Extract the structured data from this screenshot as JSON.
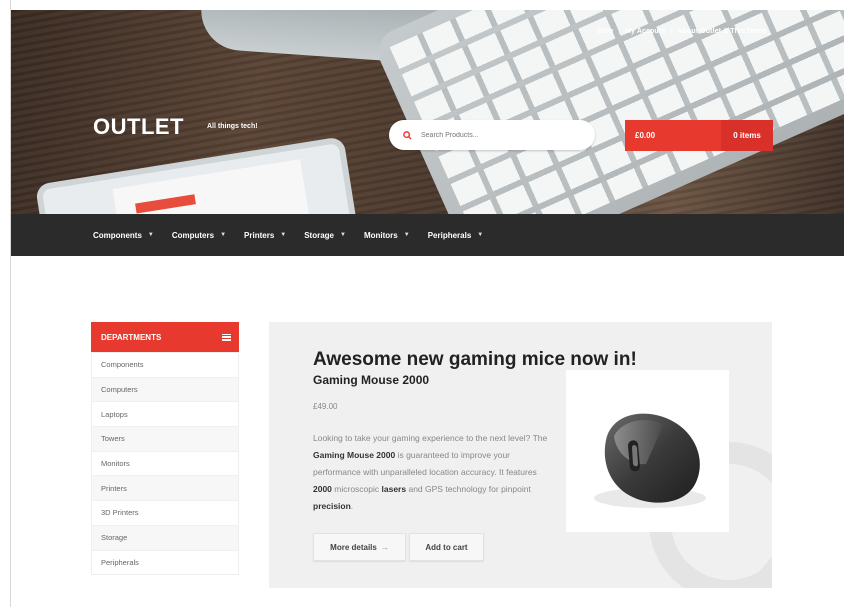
{
  "header": {
    "top_links": [
      "Blog",
      "My Account",
      "About Outlet & This Demo"
    ],
    "logo": "OUTLET",
    "tagline": "All things tech!",
    "search_placeholder": "Search Products...",
    "search_icon": "search-icon",
    "cart": {
      "total": "£0.00",
      "items": "0 items"
    }
  },
  "nav": {
    "items": [
      "Components",
      "Computers",
      "Printers",
      "Storage",
      "Monitors",
      "Peripherals"
    ],
    "chevron_icon": "chevron-down-icon"
  },
  "departments": {
    "title": "DEPARTMENTS",
    "icon": "menu-icon",
    "items": [
      "Components",
      "Computers",
      "Laptops",
      "Towers",
      "Monitors",
      "Printers",
      "3D Printers",
      "Storage",
      "Peripherals"
    ]
  },
  "feature": {
    "headline": "Awesome new gaming mice now in!",
    "product_name": "Gaming Mouse 2000",
    "price": "£49.00",
    "desc": {
      "p1": "Looking to take your gaming experience to the next level? The ",
      "b1": "Gaming Mouse 2000",
      "p2": " is guaranteed to improve your performance with unparalleled location accuracy. It features ",
      "b2": "2000",
      "p3": " microscopic ",
      "b3": "lasers",
      "p4": " and GPS technology for pinpoint ",
      "b4": "precision",
      "p5": "."
    },
    "more_button": "More details",
    "more_arrow": "→",
    "cart_button": "Add to cart"
  },
  "colors": {
    "accent": "#e8392f",
    "nav_bg": "#2b2b2b"
  }
}
